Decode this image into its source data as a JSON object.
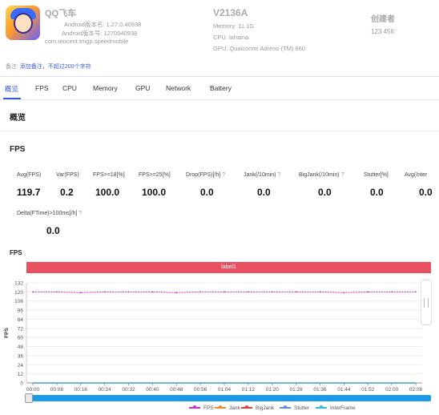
{
  "app": {
    "name": "QQ飞车",
    "android_version_name": "Android版本名: 1.27.0.40938",
    "android_version_code": "Android版本号: 1270040938",
    "package": "com.tencent.tmgp.speedmobile"
  },
  "device": {
    "name": "V2136A",
    "memory": "Memory: 11.1G",
    "cpu": "CPU: lahaina",
    "gpu": "GPU: Qualcomm Adreno (TM) 660"
  },
  "creator": {
    "label": "创建者",
    "value": "123 456"
  },
  "note": {
    "label": "备注:",
    "link": "添加备注，不超过200个字符"
  },
  "tabs": [
    "概览",
    "FPS",
    "CPU",
    "Memory",
    "GPU",
    "Network",
    "Battery"
  ],
  "section_title": "概览",
  "fps_section": {
    "title": "FPS",
    "metrics": [
      {
        "label": "Avg(FPS)",
        "value": "119.7",
        "help": ""
      },
      {
        "label": "Var(FPS)",
        "value": "0.2",
        "help": ""
      },
      {
        "label": "FPS>=18[%]",
        "value": "100.0",
        "help": ""
      },
      {
        "label": "FPS>=25[%]",
        "value": "100.0",
        "help": ""
      },
      {
        "label": "Drop(FPS)[/h]",
        "value": "0.0",
        "help": "?"
      },
      {
        "label": "Jank(/10min)",
        "value": "0.0",
        "help": "?"
      },
      {
        "label": "BigJank(/10min)",
        "value": "0.0",
        "help": "?"
      },
      {
        "label": "Stutter[%]",
        "value": "0.0",
        "help": ""
      },
      {
        "label": "Avg(Inter",
        "value": "0.0",
        "help": ""
      }
    ],
    "metric2": {
      "label": "Delta(FTime)>100ms[/h]",
      "value": "0.0",
      "help": "?"
    }
  },
  "chart": {
    "title": "FPS",
    "label_bar": "label1",
    "legend_colors": {
      "FPS": "#cc33cc",
      "Jank": "#f08a30",
      "BigJank": "#d94040",
      "Stutter": "#5b8fe0",
      "InterFrame": "#38b8e0"
    }
  },
  "chart_data": {
    "type": "line",
    "ylabel": "FPS",
    "ylim": [
      0,
      132
    ],
    "yticks": [
      0,
      12,
      24,
      36,
      48,
      60,
      72,
      84,
      96,
      108,
      120,
      132
    ],
    "categories": [
      "00:00",
      "00:08",
      "00:16",
      "00:24",
      "00:32",
      "00:40",
      "00:48",
      "00:56",
      "01:04",
      "01:12",
      "01:20",
      "01:28",
      "01:36",
      "01:44",
      "01:52",
      "02:00",
      "02:08"
    ],
    "series": [
      {
        "name": "FPS",
        "values": [
          120,
          120,
          119,
          120,
          120,
          120,
          119,
          120,
          120,
          120,
          120,
          120,
          120,
          119,
          120,
          120,
          120
        ]
      },
      {
        "name": "Jank",
        "values": [
          0,
          0,
          0,
          0,
          0,
          0,
          0,
          0,
          0,
          0,
          0,
          0,
          0,
          0,
          0,
          0,
          0
        ]
      },
      {
        "name": "BigJank",
        "values": [
          0,
          0,
          0,
          0,
          0,
          0,
          0,
          0,
          0,
          0,
          0,
          0,
          0,
          0,
          0,
          0,
          0
        ]
      },
      {
        "name": "Stutter",
        "values": [
          0,
          0,
          0,
          0,
          0,
          0,
          0,
          0,
          0,
          0,
          0,
          0,
          0,
          0,
          0,
          0,
          0
        ]
      },
      {
        "name": "InterFrame",
        "values": [
          0,
          0,
          0,
          0,
          0,
          0,
          0,
          0,
          0,
          0,
          0,
          0,
          0,
          0,
          0,
          0,
          0
        ]
      }
    ],
    "grid": true,
    "legend": "bottom"
  }
}
